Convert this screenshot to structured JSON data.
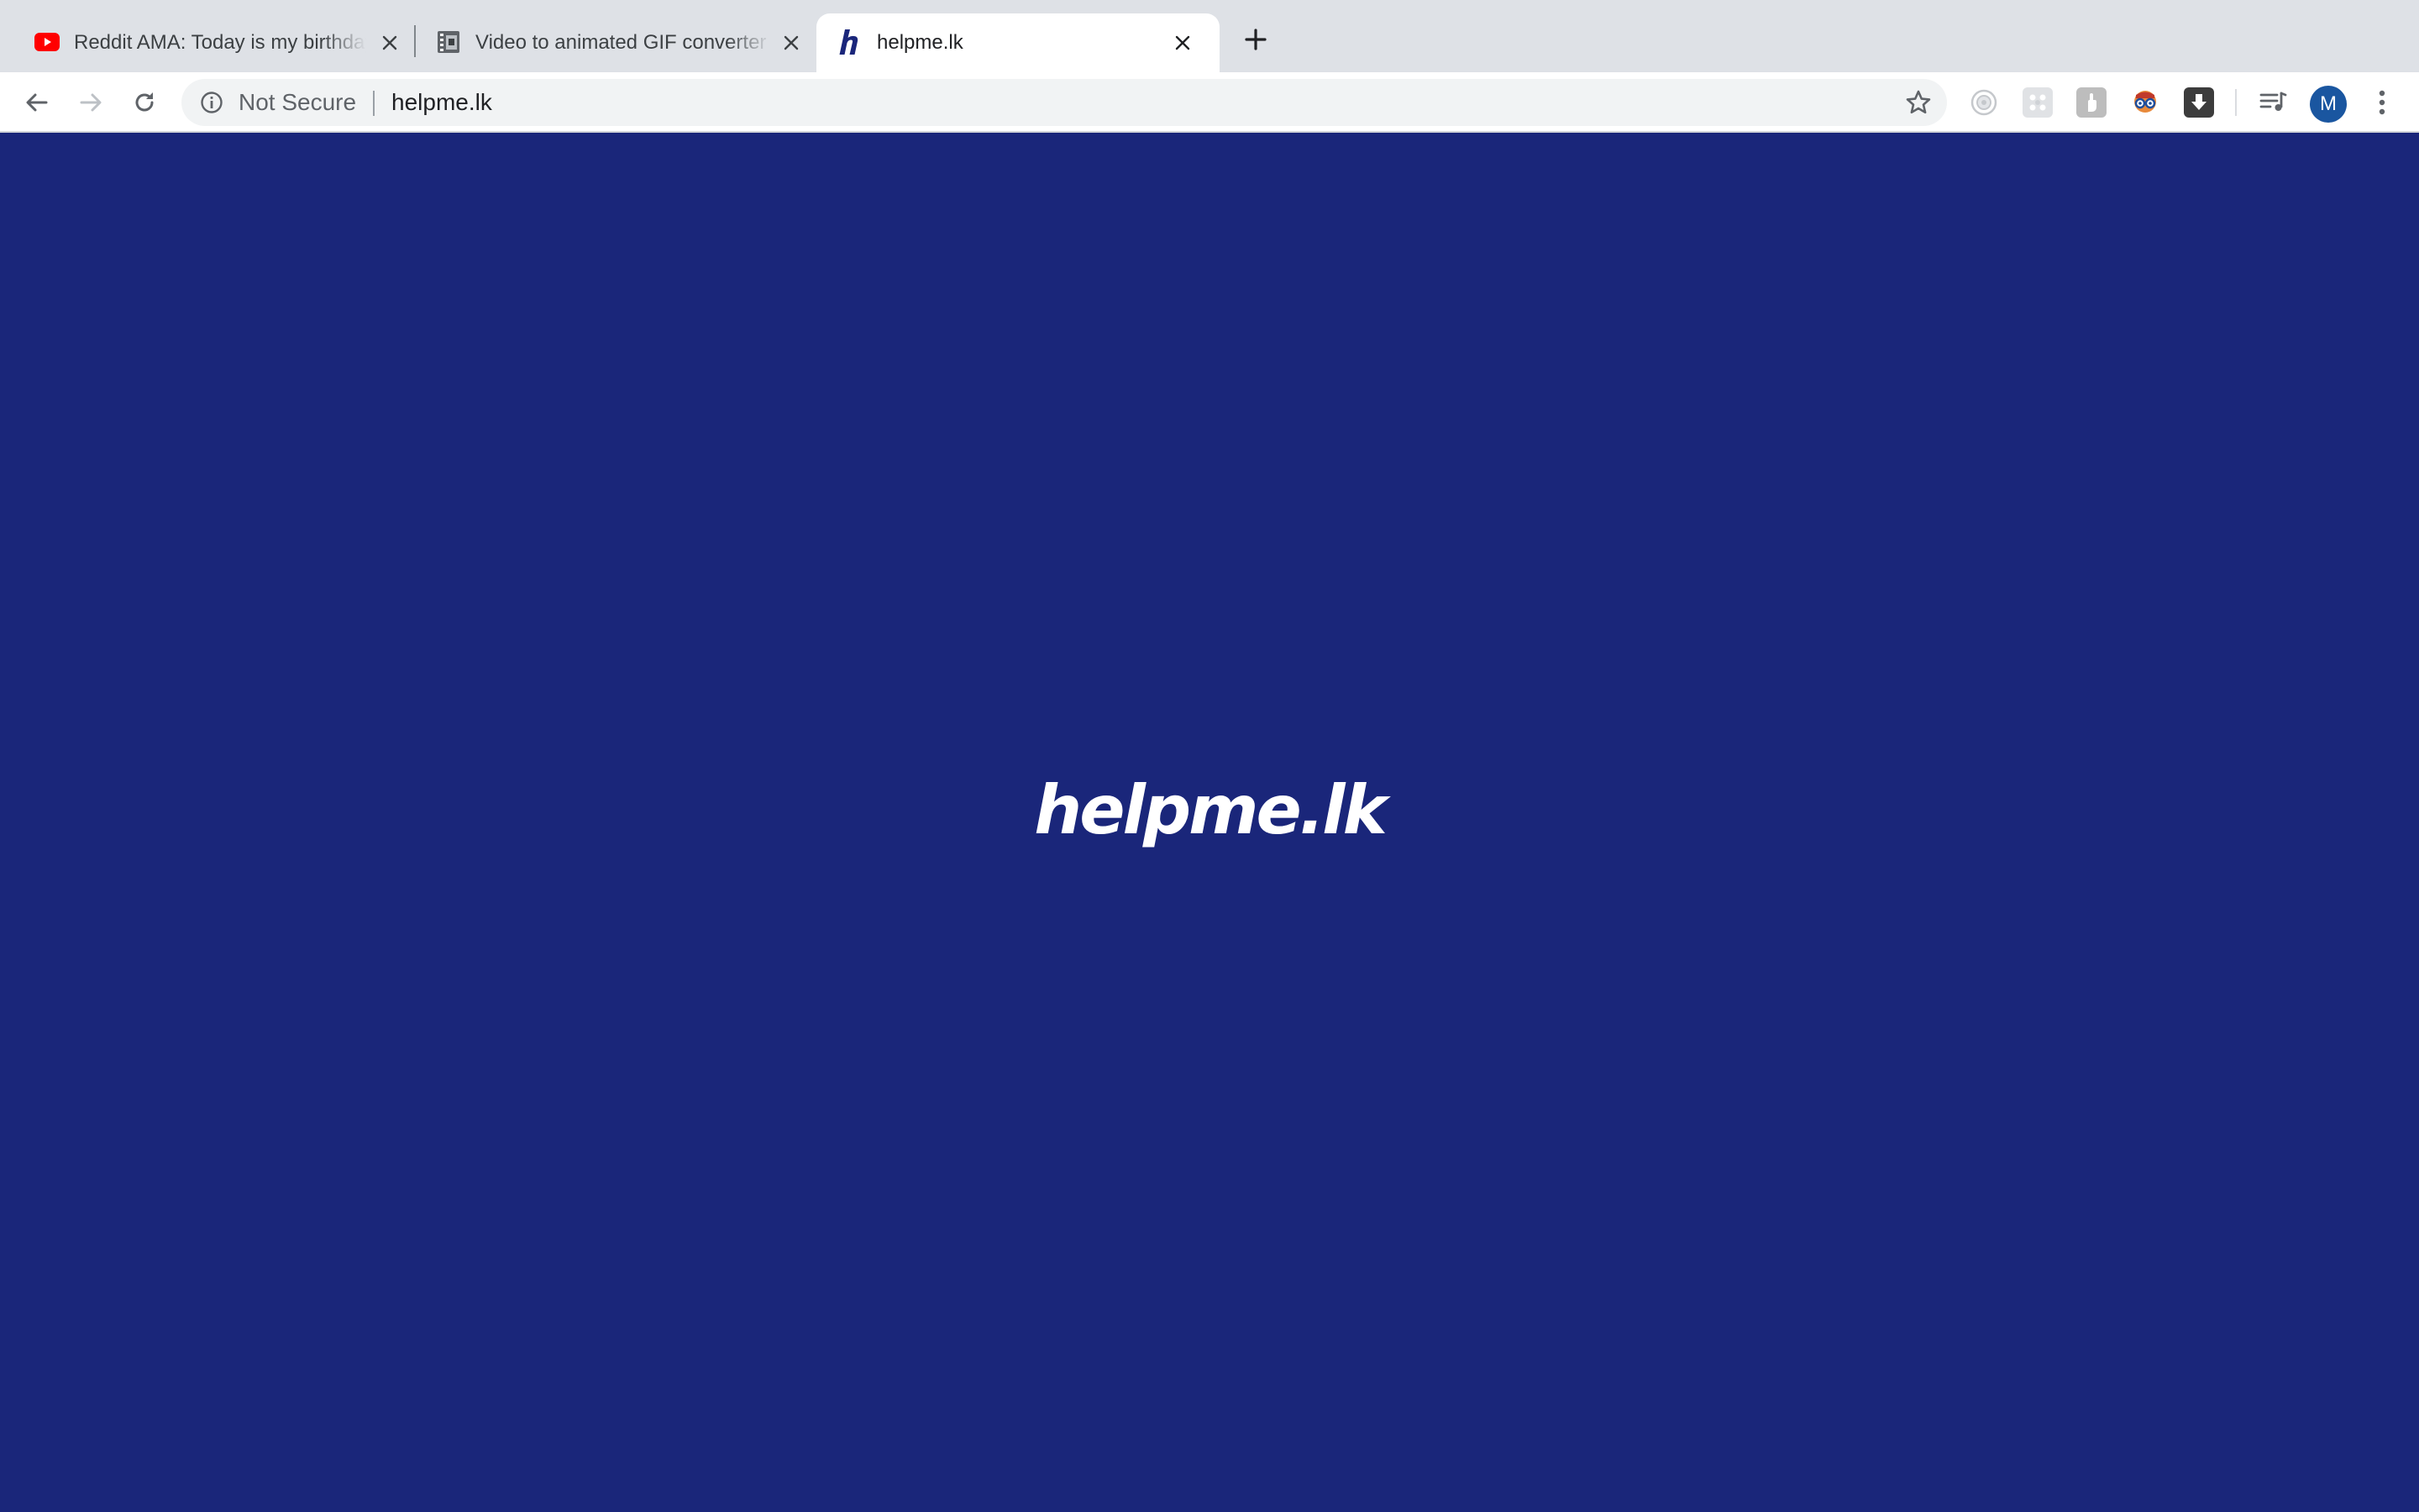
{
  "colors": {
    "page_background": "#1a267a",
    "youtube_red": "#ff0000",
    "brand_navy": "#1a267a",
    "avatar_blue": "#1a56a0"
  },
  "tabs": [
    {
      "title": "Reddit AMA: Today is my birthday",
      "icon": "youtube-icon",
      "active": false
    },
    {
      "title": "Video to animated GIF converter",
      "icon": "film-icon",
      "active": false
    },
    {
      "title": "helpme.lk",
      "icon": "helpme-h-icon",
      "active": true
    }
  ],
  "toolbar": {
    "back_icon": "back-arrow-icon",
    "forward_icon": "forward-arrow-icon",
    "reload_icon": "reload-icon",
    "security_label": "Not Secure",
    "url": "helpme.lk",
    "bookmark_icon": "star-icon",
    "extensions": [
      "screen-recorder-icon",
      "grid-extension-icon",
      "hand-extension-icon",
      "glasses-extension-icon",
      "download-extension-icon"
    ],
    "media_icon": "media-queue-icon",
    "profile_initial": "M",
    "menu_icon": "kebab-menu-icon"
  },
  "page": {
    "logo_text": "helpme.lk"
  }
}
